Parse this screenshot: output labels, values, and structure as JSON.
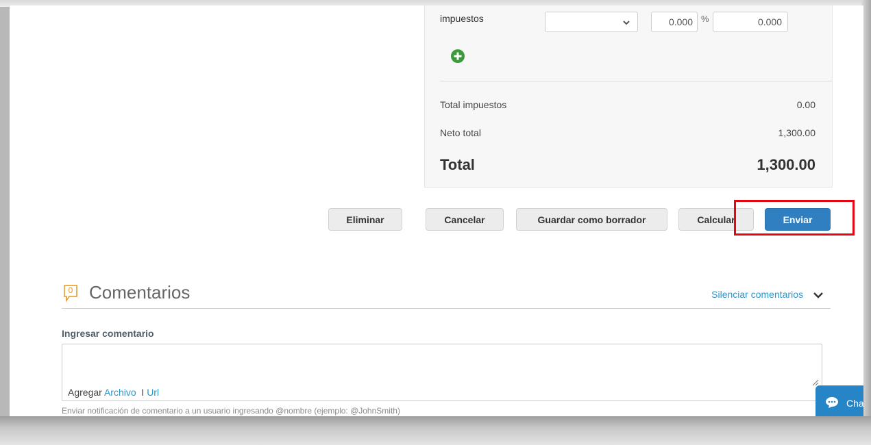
{
  "summary": {
    "tax_label": "impuestos",
    "tax_percent": "0.000",
    "percent_sign": "%",
    "tax_amount": "0.000",
    "rows": [
      {
        "label": "Total impuestos",
        "value": "0.00"
      },
      {
        "label": "Neto total",
        "value": "1,300.00"
      }
    ],
    "total_label": "Total",
    "total_value": "1,300.00"
  },
  "actions": {
    "delete": "Eliminar",
    "cancel": "Cancelar",
    "save_draft": "Guardar como borrador",
    "calculate": "Calcular",
    "send": "Enviar"
  },
  "comments": {
    "count": "0",
    "title": "Comentarios",
    "mute_link": "Silenciar comentarios",
    "input_label": "Ingresar comentario",
    "attach_prefix": "Agregar",
    "attach_file": "Archivo",
    "attach_separator": "I",
    "attach_url": "Url",
    "hint": "Enviar notificación de comentario a un usuario ingresando @nombre (ejemplo: @JohnSmith)"
  },
  "chat": {
    "label": "Chat"
  },
  "colors": {
    "primary": "#2f7fc1",
    "link": "#2a97c9",
    "add_icon": "#3c9a3c",
    "highlight": "#e30613",
    "comment_badge": "#e8941a"
  }
}
